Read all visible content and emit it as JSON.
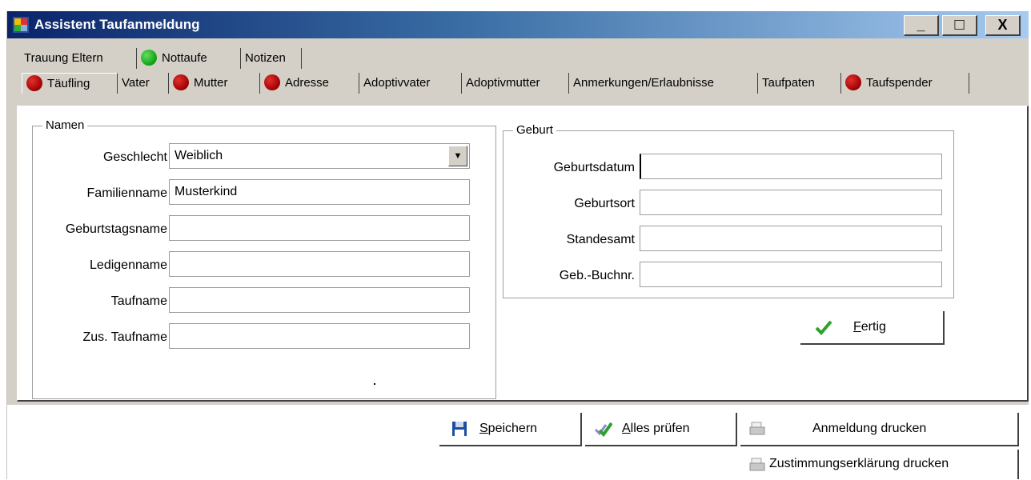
{
  "window": {
    "title": "Assistent Taufanmeldung",
    "controls": {
      "minimize": "_",
      "maximize": "□",
      "close": "X"
    }
  },
  "tabs_top": [
    {
      "label": "Trauung Eltern",
      "status": "none"
    },
    {
      "label": "Nottaufe",
      "status": "green"
    },
    {
      "label": "Notizen",
      "status": "none"
    }
  ],
  "tabs_main": [
    {
      "label": "Täufling",
      "status": "red",
      "active": true
    },
    {
      "label": "Vater",
      "status": "none"
    },
    {
      "label": "Mutter",
      "status": "red"
    },
    {
      "label": "Adresse",
      "status": "red"
    },
    {
      "label": "Adoptivvater",
      "status": "none"
    },
    {
      "label": "Adoptivmutter",
      "status": "none"
    },
    {
      "label": "Anmerkungen/Erlaubnisse",
      "status": "none"
    },
    {
      "label": "Taufpaten",
      "status": "none"
    },
    {
      "label": "Taufspender",
      "status": "red"
    }
  ],
  "namen": {
    "legend": "Namen",
    "geschlecht": {
      "label": "Geschlecht",
      "value": "Weiblich"
    },
    "familienname": {
      "label": "Familienname",
      "value": "Musterkind"
    },
    "geburtstagsname": {
      "label": "Geburtstagsname",
      "value": ""
    },
    "ledigenname": {
      "label": "Ledigenname",
      "value": ""
    },
    "taufname": {
      "label": "Taufname",
      "value": ""
    },
    "zus_taufname": {
      "label": "Zus. Taufname",
      "value": ""
    }
  },
  "geburt": {
    "legend": "Geburt",
    "geburtsdatum": {
      "label": "Geburtsdatum",
      "value": ""
    },
    "geburtsort": {
      "label": "Geburtsort",
      "value": ""
    },
    "standesamt": {
      "label": "Standesamt",
      "value": ""
    },
    "geb_buchnr": {
      "label": "Geb.-Buchnr.",
      "value": ""
    }
  },
  "buttons": {
    "fertig": {
      "accel": "F",
      "rest": "ertig"
    },
    "speichern": {
      "accel": "S",
      "rest": "peichern"
    },
    "alles_pruefen": {
      "accel": "A",
      "rest": "lles prüfen"
    },
    "anmeldung_drucken": "Anmeldung drucken",
    "zustimmung_drucken": "Zustimmungserklärung drucken"
  },
  "colors": {
    "status_red": "#c00000",
    "status_green": "#10a010",
    "title_start": "#0a246a",
    "title_end": "#a6caf0"
  },
  "icons": {
    "app": "app-window-icon",
    "fertig": "checkmark-icon",
    "speichern": "floppy-disk-icon",
    "alles_pruefen": "double-checkmark-icon",
    "drucken": "printer-icon"
  }
}
